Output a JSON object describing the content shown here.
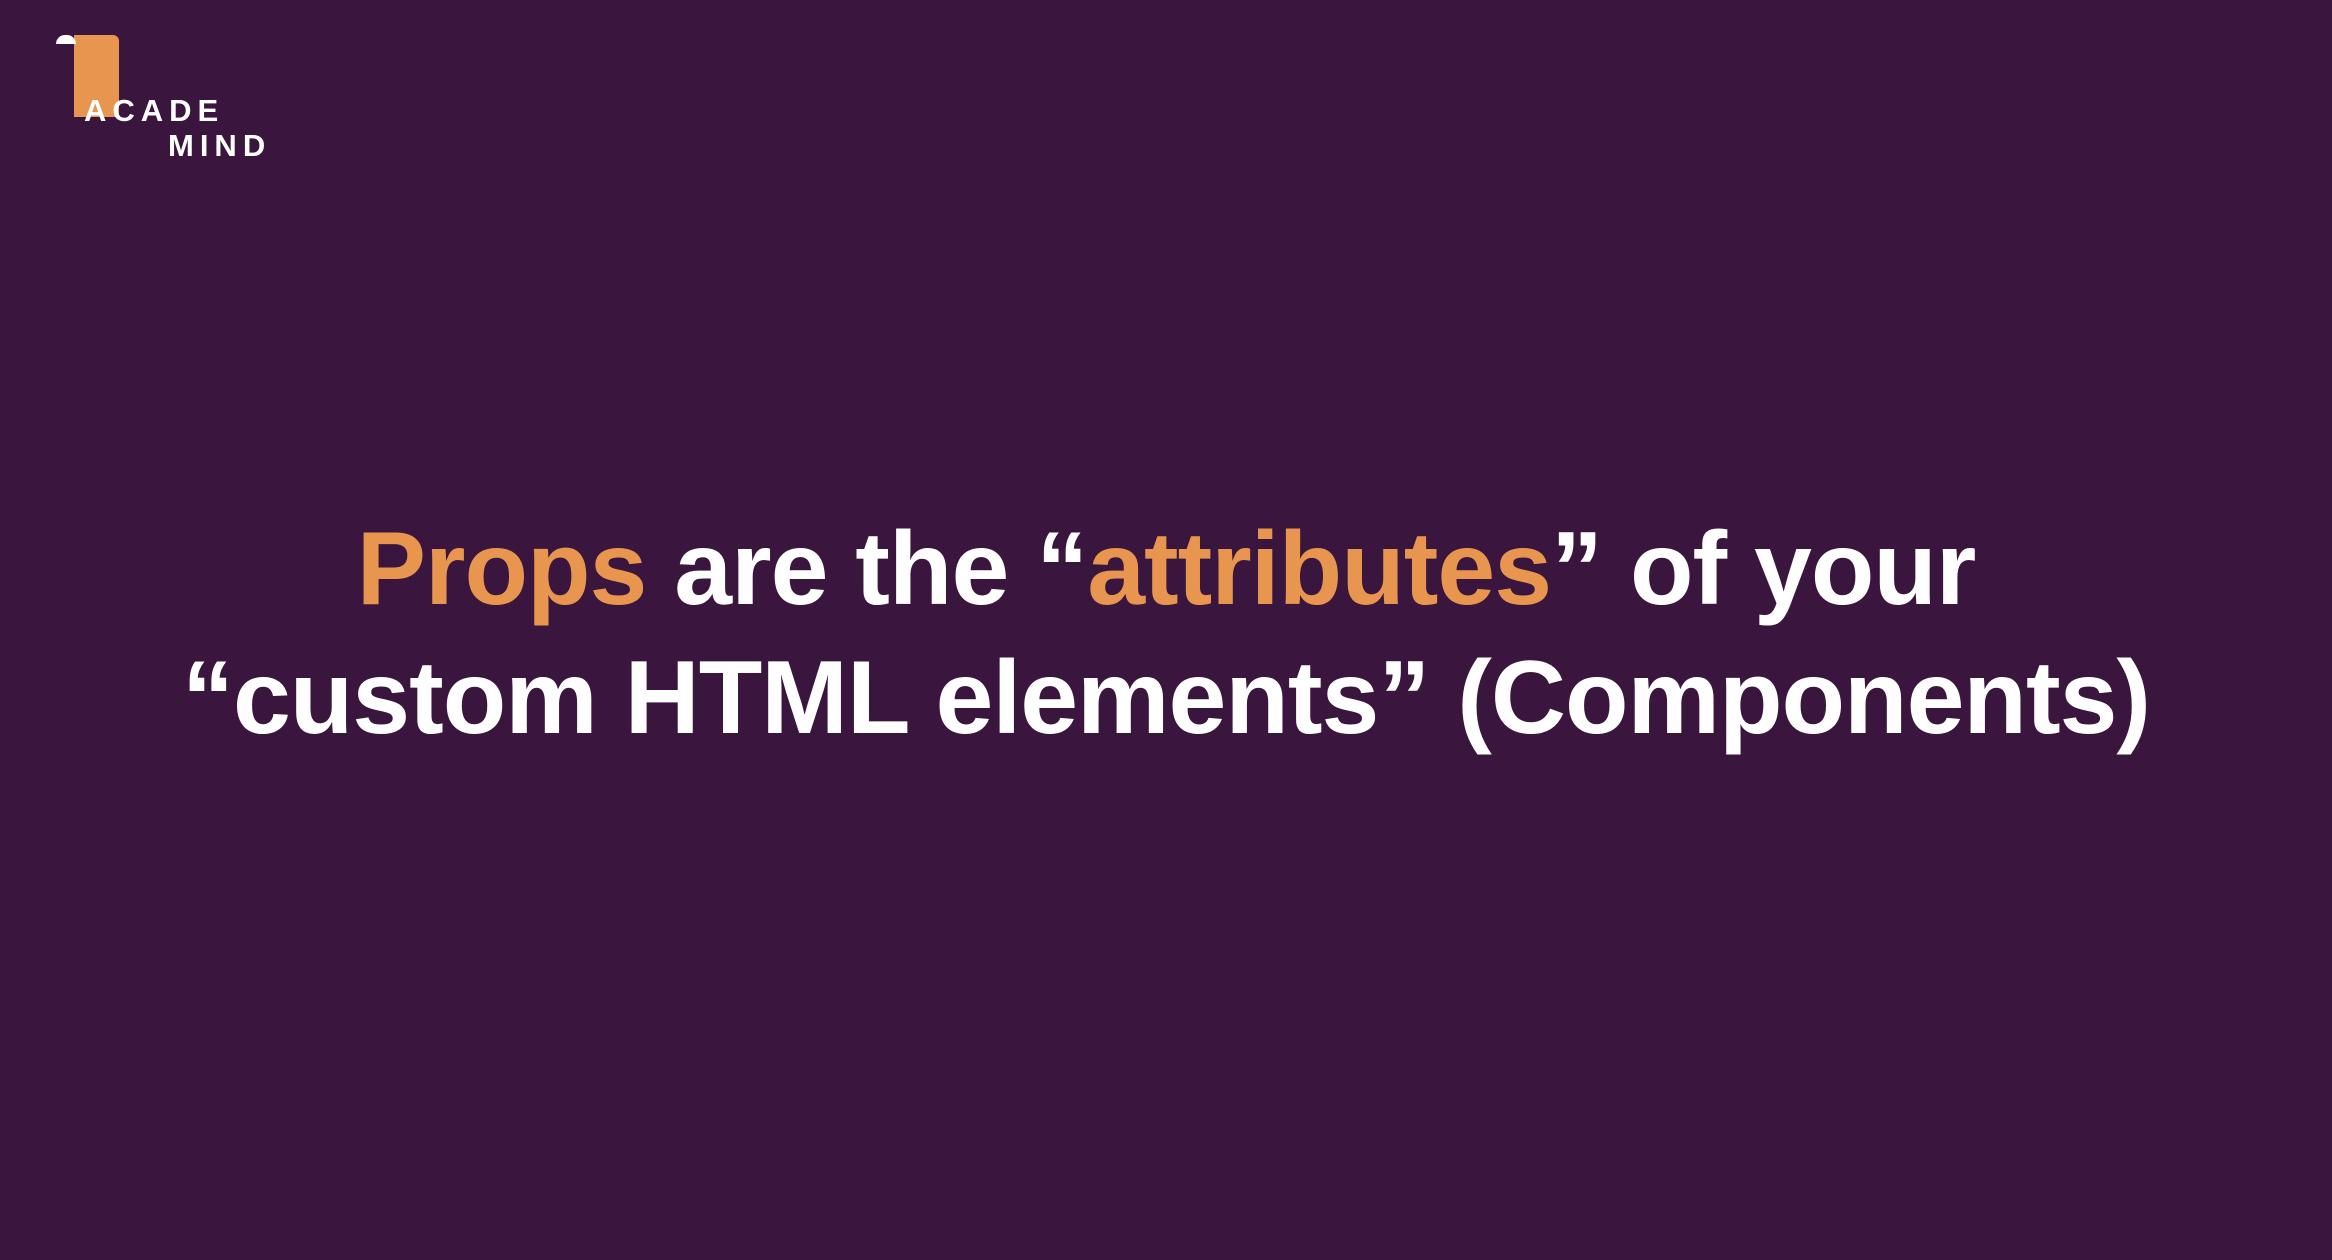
{
  "logo": {
    "line1": "ACADE",
    "line2": "MIND"
  },
  "headline": {
    "line1": [
      {
        "text": "Props",
        "accent": true
      },
      {
        "text": " are the “",
        "accent": false
      },
      {
        "text": "attributes",
        "accent": true
      },
      {
        "text": "” of your",
        "accent": false
      }
    ],
    "line2": "“custom HTML elements” (Components)"
  },
  "colors": {
    "background": "#3a153d",
    "accent": "#e8964f",
    "text": "#ffffff"
  }
}
